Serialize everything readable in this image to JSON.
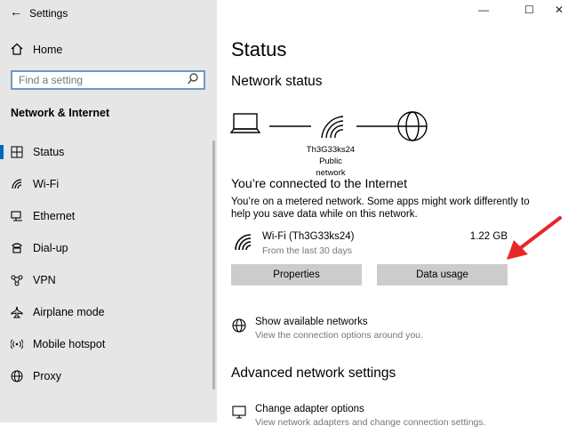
{
  "window": {
    "title": "Settings",
    "controls": {
      "minimize": "—",
      "maximize": "☐",
      "close": "✕"
    }
  },
  "sidebar": {
    "home_label": "Home",
    "search_placeholder": "Find a setting",
    "section_title": "Network & Internet",
    "items": [
      {
        "label": "Status",
        "icon": "status-icon",
        "selected": true
      },
      {
        "label": "Wi-Fi",
        "icon": "wifi-icon"
      },
      {
        "label": "Ethernet",
        "icon": "ethernet-icon"
      },
      {
        "label": "Dial-up",
        "icon": "dialup-icon"
      },
      {
        "label": "VPN",
        "icon": "vpn-icon"
      },
      {
        "label": "Airplane mode",
        "icon": "airplane-icon"
      },
      {
        "label": "Mobile hotspot",
        "icon": "hotspot-icon"
      },
      {
        "label": "Proxy",
        "icon": "globe-icon"
      }
    ]
  },
  "main": {
    "title": "Status",
    "network_status_heading": "Network status",
    "network_name": "Th3G33ks24",
    "network_type": "Public network",
    "connected_heading": "You’re connected to the Internet",
    "description": "You’re on a metered network. Some apps might work differently to help you save data while on this network.",
    "connection": {
      "name": "Wi-Fi (Th3G33ks24)",
      "period": "From the last 30 days",
      "data_used": "1.22 GB"
    },
    "buttons": {
      "properties": "Properties",
      "data_usage": "Data usage"
    },
    "show_networks": {
      "title": "Show available networks",
      "subtitle": "View the connection options around you."
    },
    "advanced_heading": "Advanced network settings",
    "adapter_options": {
      "title": "Change adapter options",
      "subtitle": "View network adapters and change connection settings."
    }
  },
  "colors": {
    "accent": "#0067c0",
    "annotation_arrow": "#e8262a"
  }
}
